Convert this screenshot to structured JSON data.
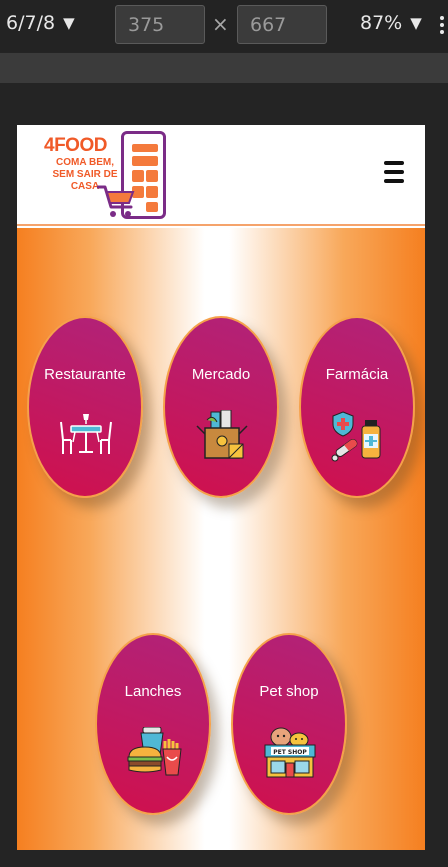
{
  "devtools": {
    "device": "6/7/8",
    "width": "375",
    "separator": "×",
    "height": "667",
    "zoom": "87%"
  },
  "header": {
    "logo_brand": "4FOOD",
    "logo_tagline": "COMA BEM, SEM SAIR DE CASA"
  },
  "categories": [
    {
      "label": "Restaurante",
      "icon": "dining-table-icon"
    },
    {
      "label": "Mercado",
      "icon": "grocery-box-icon"
    },
    {
      "label": "Farmácia",
      "icon": "pharmacy-icon"
    },
    {
      "label": "Lanches",
      "icon": "fast-food-icon"
    },
    {
      "label": "Pet shop",
      "icon": "pet-shop-icon"
    }
  ],
  "colors": {
    "brand_orange": "#f05a28",
    "brand_purple": "#7b2c87",
    "card_fill": "#c8155a",
    "card_border": "#f5a14b"
  }
}
